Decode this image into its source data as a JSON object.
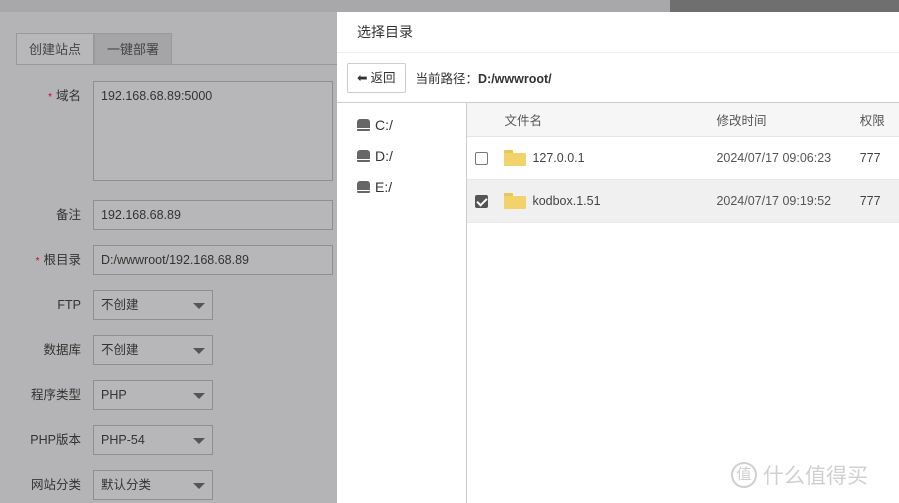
{
  "form": {
    "tabs": [
      "创建站点",
      "一键部署"
    ],
    "domain": {
      "label": "域名",
      "required": "*",
      "value": "192.168.68.89:5000"
    },
    "remark": {
      "label": "备注",
      "value": "192.168.68.89"
    },
    "root": {
      "label": "根目录",
      "required": "*",
      "value": "D:/wwwroot/192.168.68.89"
    },
    "ftp": {
      "label": "FTP",
      "value": "不创建"
    },
    "db": {
      "label": "数据库",
      "value": "不创建"
    },
    "type": {
      "label": "程序类型",
      "value": "PHP"
    },
    "php": {
      "label": "PHP版本",
      "value": "PHP-54"
    },
    "category": {
      "label": "网站分类",
      "value": "默认分类"
    }
  },
  "modal": {
    "title": "选择目录",
    "back": "返回",
    "path_label": "当前路径：",
    "path": "D:/wwwroot/",
    "drives": [
      "C:/",
      "D:/",
      "E:/"
    ],
    "columns": [
      "文件名",
      "修改时间",
      "权限"
    ],
    "rows": [
      {
        "name": "127.0.0.1",
        "time": "2024/07/17 09:06:23",
        "perm": "777",
        "checked": false
      },
      {
        "name": "kodbox.1.51",
        "time": "2024/07/17 09:19:52",
        "perm": "777",
        "checked": true
      }
    ]
  },
  "watermark": {
    "logo": "值",
    "text": "什么值得买"
  }
}
